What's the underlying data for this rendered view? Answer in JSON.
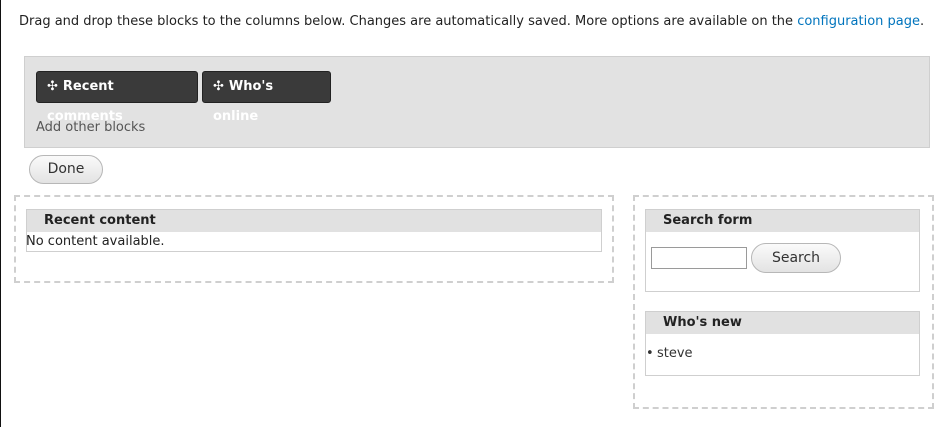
{
  "instructions": {
    "text": "Drag and drop these blocks to the columns below. Changes are automatically saved. More options are available on the",
    "link": "configuration page",
    "trailing": "."
  },
  "tray": {
    "blocks": [
      {
        "label": "Recent comments",
        "icon": "move-icon"
      },
      {
        "label": "Who's online",
        "icon": "move-icon"
      }
    ],
    "add_other": "Add other blocks"
  },
  "done_button": "Done",
  "regions": {
    "left": {
      "blocks": [
        {
          "title": "Recent content",
          "content": "No content available."
        }
      ]
    },
    "right": {
      "search": {
        "title": "Search form",
        "input_value": "",
        "button": "Search"
      },
      "whos_new": {
        "title": "Who's new",
        "items": [
          "steve"
        ]
      }
    }
  },
  "colors": {
    "tray_background": "#e2e2e2",
    "block_dark": "#3a3a3a",
    "block_title_bg": "#e1e1e1",
    "link": "#0074bd"
  }
}
